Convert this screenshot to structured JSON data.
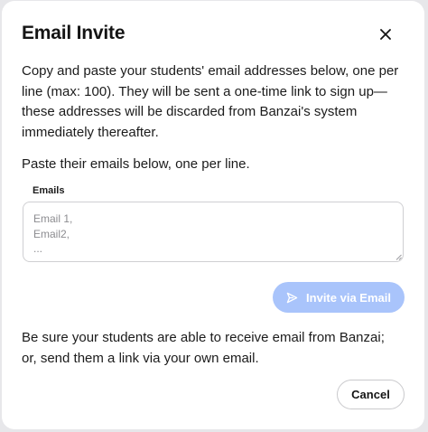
{
  "dialog": {
    "title": "Email Invite",
    "close_icon": "close-icon"
  },
  "content": {
    "description": "Copy and paste your students' email addresses below, one per line (max: 100). They will be sent a one-time link to sign up—these addresses will be discarded from Banzai's system immediately thereafter.",
    "instruction": "Paste their emails below, one per line.",
    "note": "Be sure your students are able to receive email from Banzai; or, send them a link via your own email."
  },
  "emails": {
    "label": "Emails",
    "placeholder": "Email 1,\nEmail2,\n...",
    "value": ""
  },
  "actions": {
    "invite_label": "Invite via Email",
    "invite_icon": "send-icon",
    "cancel_label": "Cancel"
  },
  "colors": {
    "invite_button_disabled": "#a9c4fb",
    "text": "#1b1b1b"
  }
}
